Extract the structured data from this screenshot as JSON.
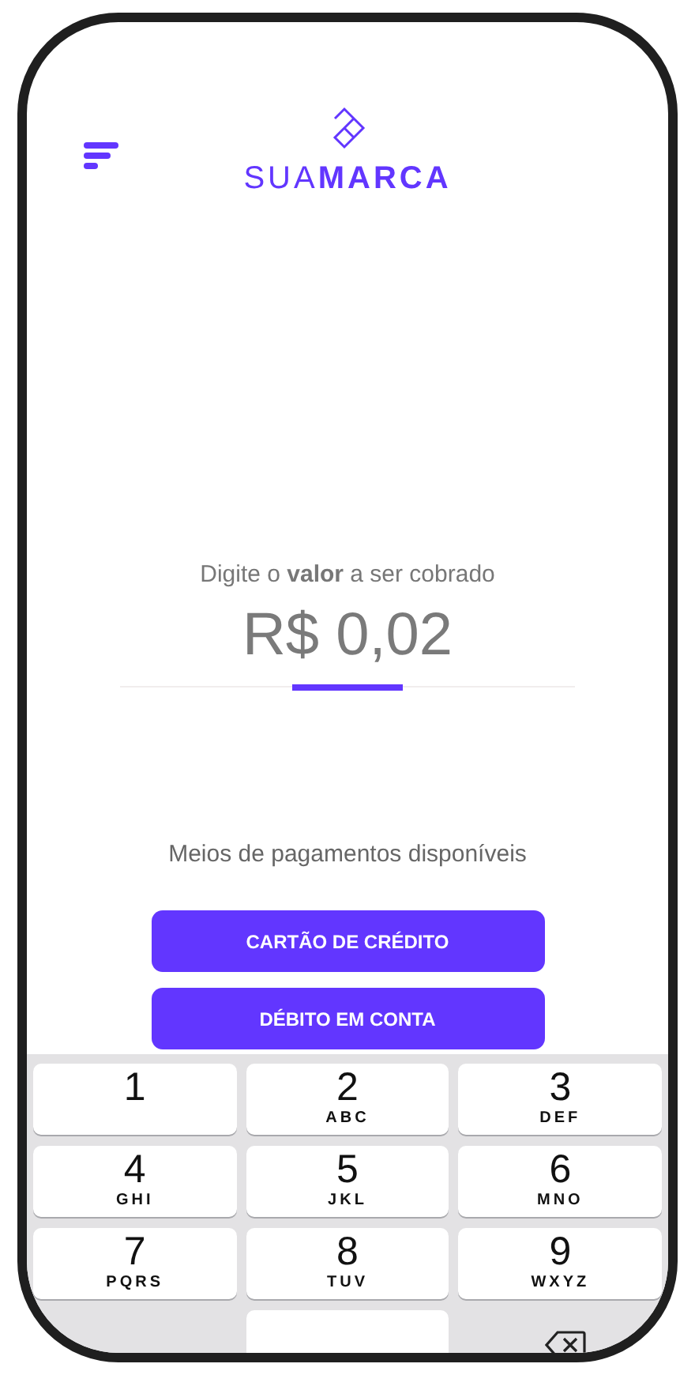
{
  "header": {
    "brand": "SUA**MARCA**"
  },
  "amount": {
    "prompt": "Digite o **valor** a ser cobrado",
    "value": "R$ 0,02"
  },
  "payment": {
    "title": "Meios de pagamentos disponíveis",
    "buttons": [
      "CARTÃO DE CRÉDITO",
      "DÉBITO EM CONTA"
    ]
  },
  "keypad": {
    "keys": [
      {
        "kind": "digit",
        "digit": "1"
      },
      {
        "kind": "digit",
        "digit": "2",
        "letters": "ABC"
      },
      {
        "kind": "digit",
        "digit": "3",
        "letters": "DEF"
      },
      {
        "kind": "digit",
        "digit": "4",
        "letters": "GHI"
      },
      {
        "kind": "digit",
        "digit": "5",
        "letters": "JKL"
      },
      {
        "kind": "digit",
        "digit": "6",
        "letters": "MNO"
      },
      {
        "kind": "digit",
        "digit": "7",
        "letters": "PQRS"
      },
      {
        "kind": "digit",
        "digit": "8",
        "letters": "TUV"
      },
      {
        "kind": "digit",
        "digit": "9",
        "letters": "WXYZ"
      },
      {
        "kind": "blank"
      },
      {
        "kind": "digit"
      },
      {
        "kind": "backspace"
      }
    ]
  }
}
